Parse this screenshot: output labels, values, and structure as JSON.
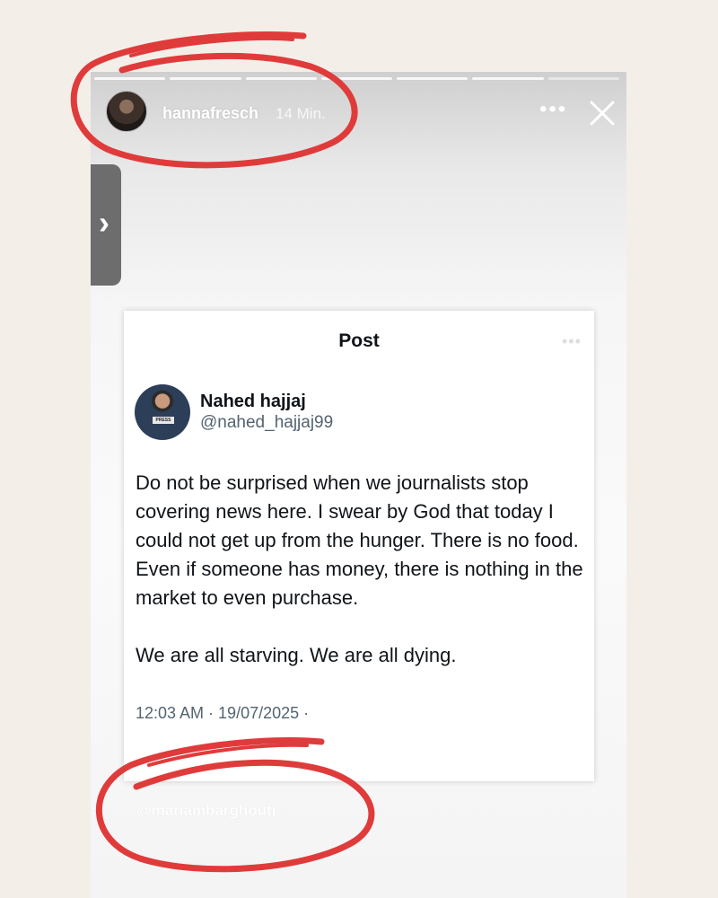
{
  "story": {
    "username": "hannafresch",
    "time": "14 Min.",
    "more_icon": "more-dots-icon",
    "close_icon": "close-icon",
    "side_tab_icon": "chevron-right-icon",
    "progress_segments": 7,
    "progress_viewed": 6
  },
  "post": {
    "title": "Post",
    "author_name": "Nahed hajjaj",
    "author_handle": "@nahed_hajjaj99",
    "avatar_badge": "PRESS",
    "paragraphs": [
      "Do not be surprised when we journalists stop covering news here. I swear by God that today I could not get up from the hunger. There is no food. Even if someone has money, there is nothing in the market to even purchase.",
      "We are all starving. We are all dying."
    ],
    "timestamp": "12:03 AM · 19/07/2025 ·"
  },
  "watermark": "@mariambarghouti",
  "colors": {
    "page_background": "#f3efe8",
    "annotation_red": "#e03b3b",
    "text_primary": "#0f1419",
    "text_secondary": "#536471"
  }
}
